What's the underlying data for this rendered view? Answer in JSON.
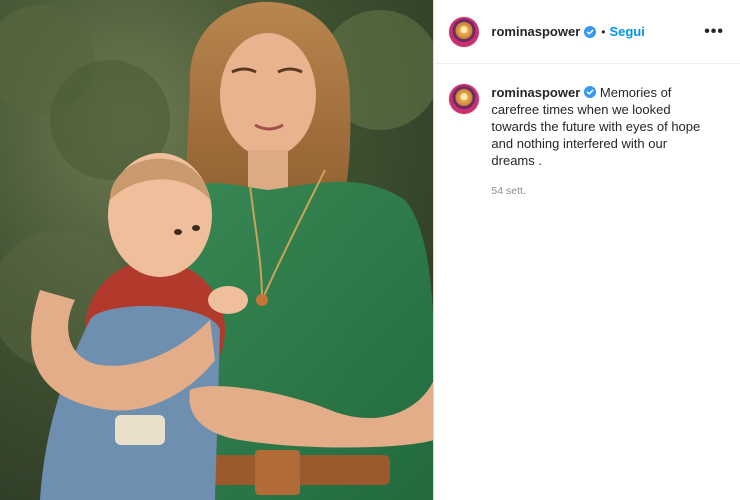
{
  "header": {
    "username": "rominaspower",
    "separator": "•",
    "follow_label": "Segui",
    "more_label": "•••"
  },
  "caption": {
    "username": "rominaspower",
    "text": "Memories of carefree times when we looked towards the future with eyes of hope and nothing interfered with our dreams .",
    "time": "54 sett."
  },
  "colors": {
    "accent": "#0095f6",
    "text": "#262626",
    "muted": "#8e8e8e",
    "verified": "#3897f0"
  },
  "icons": {
    "verified": "verified-badge-icon",
    "more": "more-options-icon"
  }
}
